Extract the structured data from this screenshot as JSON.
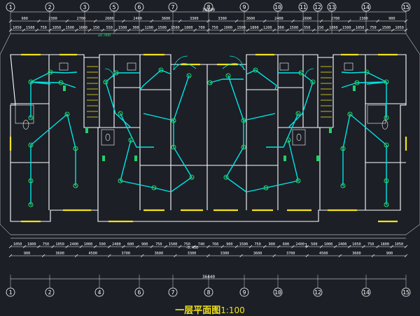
{
  "drawing": {
    "title_cn": "一层平面图",
    "title_scale": "1:100",
    "top_total": "36440",
    "bottom_total": "36440",
    "level_mark_top": "±0.000",
    "level_mark_bottom": "-0.450",
    "small_mark": "1"
  },
  "axes": [
    "1",
    "2",
    "3",
    "4",
    "5",
    "6",
    "7",
    "8",
    "9",
    "10",
    "11",
    "12",
    "13",
    "14",
    "15"
  ],
  "top_axes_labels": [
    "1",
    "2",
    "3",
    "5",
    "6",
    "7",
    "8",
    "9",
    "10",
    "11",
    "12",
    "13",
    "14",
    "15"
  ],
  "bottom_axes_labels": [
    "1",
    "2",
    "4",
    "6",
    "7",
    "8",
    "9",
    "10",
    "12",
    "14",
    "15"
  ],
  "top_row1": [
    "900",
    "2300",
    "2700",
    "2600",
    "2400",
    "3600",
    "3300",
    "3300",
    "3600",
    "2400",
    "2600",
    "2700",
    "2300",
    "900"
  ],
  "top_row2": [
    "1050",
    "1500",
    "750",
    "1050",
    "1500",
    "1000",
    "150",
    "550",
    "1500",
    "300",
    "1200",
    "1500",
    "1500",
    "1800",
    "700",
    "750",
    "1000",
    "1500",
    "1800",
    "1200",
    "300",
    "1500",
    "550",
    "150",
    "1000",
    "1500",
    "1050",
    "750",
    "1500",
    "1050"
  ],
  "bottom_row1": [
    "1050",
    "1800",
    "750",
    "1050",
    "2400",
    "1000",
    "500",
    "2400",
    "600",
    "900",
    "750",
    "1500",
    "750",
    "740",
    "760",
    "900",
    "1500",
    "750",
    "900",
    "600",
    "2400",
    "500",
    "1000",
    "2400",
    "1050",
    "750",
    "1800",
    "1050"
  ],
  "bottom_row2": [
    "900",
    "3600",
    "4500",
    "3700",
    "3600",
    "3300",
    "3300",
    "3600",
    "3700",
    "4500",
    "3600",
    "900"
  ],
  "colors": {
    "background": "#1c1f26",
    "wall": "#ffffff",
    "dim": "#ffffff",
    "wire": "#00e6e6",
    "fixture": "#21d16a",
    "window": "#f2e21a",
    "door_swing": "#00e6e6",
    "title": "#f2e21a",
    "axis_bubble": "#ffffff"
  }
}
